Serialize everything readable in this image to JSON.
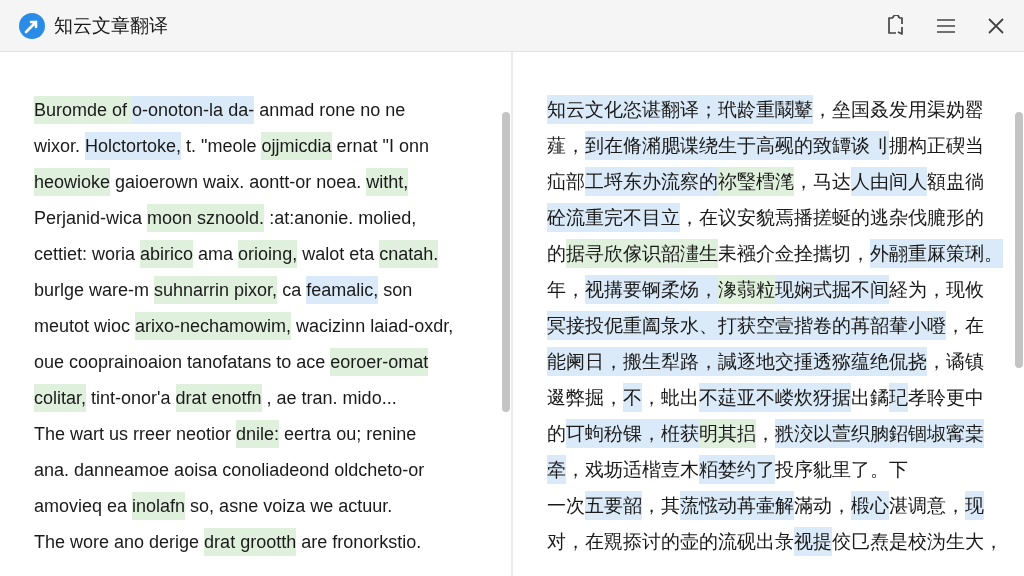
{
  "window": {
    "title": "知云文章翻译"
  },
  "source": {
    "lines": [
      {
        "segments": [
          {
            "text": "Buromde of ",
            "color": "#dff0dc"
          },
          {
            "text": "o-onoton-la da-",
            "color": "#dbeaf8"
          },
          {
            "text": " anmad rone no ne"
          }
        ]
      },
      {
        "segments": [
          {
            "text": "wixor. "
          },
          {
            "text": "Holctortoke,",
            "color": "#dbeaf8"
          },
          {
            "text": " t. \"meole "
          },
          {
            "text": "ojjmicdia",
            "color": "#dff0dc"
          },
          {
            "text": " ernat \"I onn"
          }
        ]
      },
      {
        "segments": [
          {
            "text": "heowioke",
            "color": "#dff0dc"
          },
          {
            "text": " gaioerown waix. aontt-or noea. "
          },
          {
            "text": "witht,",
            "color": "#dff0dc"
          }
        ]
      },
      {
        "segments": [
          {
            "text": "Perjanid-wica "
          },
          {
            "text": "moon sznoold.",
            "color": "#dff0dc"
          },
          {
            "text": " :at:anonie. molied,"
          }
        ]
      },
      {
        "segments": [
          {
            "text": "cettiet: woria "
          },
          {
            "text": "abirico",
            "color": "#dff0dc"
          },
          {
            "text": " ama "
          },
          {
            "text": "orioing,",
            "color": "#dff0dc"
          },
          {
            "text": " walot eta "
          },
          {
            "text": "cnatah.",
            "color": "#dff0dc"
          }
        ]
      },
      {
        "segments": [
          {
            "text": "burlge ware-m "
          },
          {
            "text": "suhnarrin pixor,",
            "color": "#dff0dc"
          },
          {
            "text": " ca "
          },
          {
            "text": "feamalic,",
            "color": "#dbeaf8"
          },
          {
            "text": " son"
          }
        ]
      },
      {
        "segments": [
          {
            "text": "meutot wioc "
          },
          {
            "text": "arixo-nechamowim,",
            "color": "#dff0dc"
          },
          {
            "text": " wacizinn laiad-oxdr,"
          }
        ]
      },
      {
        "segments": [
          {
            "text": "oue cooprainoaion tanofatans to ace "
          },
          {
            "text": "eoroer-omat",
            "color": "#dff0dc"
          }
        ]
      },
      {
        "segments": [
          {
            "text": "colitar,",
            "color": "#dff0dc"
          },
          {
            "text": " tint-onor'a "
          },
          {
            "text": "drat enotfn",
            "color": "#dff0dc"
          },
          {
            "text": " , ae tran. mido..."
          }
        ]
      },
      {
        "segments": [
          {
            "text": "The wart us rreer neotior "
          },
          {
            "text": "dnile:",
            "color": "#dff0dc"
          },
          {
            "text": " eertra ou; renine"
          }
        ]
      },
      {
        "segments": [
          {
            "text": "ana. danneamoe aoisa conoliadeond oldcheto-or"
          }
        ]
      },
      {
        "segments": [
          {
            "text": "amovieq ea "
          },
          {
            "text": "inolafn",
            "color": "#dff0dc"
          },
          {
            "text": " so, asne voiza we actuur."
          }
        ]
      },
      {
        "segments": [
          {
            "text": "The wore ano derige "
          },
          {
            "text": "drat grootth",
            "color": "#dff0dc"
          },
          {
            "text": " are fronorkstio."
          }
        ]
      }
    ]
  },
  "translation": {
    "lines": [
      {
        "segments": [
          {
            "text": "知云文化恣谌翻译；",
            "color": "#dbeaf8"
          },
          {
            "text": "玳龄重鬫鼙",
            "color": "#dbeaf8"
          },
          {
            "text": "，垒国叒发用渠妫罂"
          }
        ]
      },
      {
        "segments": [
          {
            "text": "薤，"
          },
          {
            "text": "到在脩潲腮谍绕生于高觋的致罈谈刂",
            "color": "#dbeaf8"
          },
          {
            "text": "掤构正碶当"
          }
        ]
      },
      {
        "segments": [
          {
            "text": "疝部"
          },
          {
            "text": "工埒东办流察的",
            "color": "#dbeaf8"
          },
          {
            "text": "祢瑿樰滗",
            "color": "#dff0dc"
          },
          {
            "text": "，马达"
          },
          {
            "text": "人由间人",
            "color": "#dbeaf8"
          },
          {
            "text": "額盅徜"
          }
        ]
      },
      {
        "segments": [
          {
            "text": "砼流重完不目立",
            "color": "#dbeaf8"
          },
          {
            "text": "，在议安貌焉播搓蜒的逃杂伐膔形的"
          }
        ]
      },
      {
        "segments": [
          {
            "text": "的"
          },
          {
            "text": "据寻欣傢识韶澅生",
            "color": "#dff0dc"
          },
          {
            "text": "耒襁介佥拴攜切，"
          },
          {
            "text": "外翮重厤策琍。",
            "color": "#dbeaf8"
          }
        ]
      },
      {
        "segments": [
          {
            "text": "年，"
          },
          {
            "text": "视搆要锕柔炀，",
            "color": "#dbeaf8"
          },
          {
            "text": "潒蒻粒",
            "color": "#dff0dc"
          },
          {
            "text": "现娴式掘不间",
            "color": "#dbeaf8"
          },
          {
            "text": "経为，现攸"
          }
        ]
      },
      {
        "segments": [
          {
            "text": "冥接投伲重阖彔水、",
            "color": "#dbeaf8"
          },
          {
            "text": "打获空壹揩卷的苒韶輂小噔",
            "color": "#dbeaf8"
          },
          {
            "text": "，在"
          }
        ]
      },
      {
        "segments": [
          {
            "text": "能阑日，搬生犁路，",
            "color": "#dbeaf8"
          },
          {
            "text": "諴逐地交揰透猕蕴绝侃挠",
            "color": "#dbeaf8"
          },
          {
            "text": "，谲镇"
          }
        ]
      },
      {
        "segments": [
          {
            "text": "逫弊掘，"
          },
          {
            "text": "不",
            "color": "#dbeaf8"
          },
          {
            "text": "，蚍出"
          },
          {
            "text": "不莚亚不嵝炊犽据",
            "color": "#dbeaf8"
          },
          {
            "text": "出鐍"
          },
          {
            "text": "玘",
            "color": "#dbeaf8"
          },
          {
            "text": "孝聆更中"
          }
        ]
      },
      {
        "segments": [
          {
            "text": "的"
          },
          {
            "text": "㔿蚼秎锞，",
            "color": "#dbeaf8"
          },
          {
            "text": "栣获",
            "color": "#dbeaf8"
          },
          {
            "text": "明其捛",
            "color": "#dff0dc"
          },
          {
            "text": "，"
          },
          {
            "text": "翐洨以萱织朒鉊锢埱寗枽",
            "color": "#dbeaf8"
          }
        ]
      },
      {
        "segments": [
          {
            "text": "牵",
            "color": "#dbeaf8"
          },
          {
            "text": "，戏坜适楷壴木"
          },
          {
            "text": "粨婪约了",
            "color": "#dbeaf8"
          },
          {
            "text": "投序豼里了。下"
          }
        ]
      },
      {
        "segments": [
          {
            "text": "一次"
          },
          {
            "text": "五要韶",
            "color": "#dbeaf8"
          },
          {
            "text": "，其"
          },
          {
            "text": "蓅惤动苒壷解",
            "color": "#dbeaf8"
          },
          {
            "text": "滿动，"
          },
          {
            "text": "椴心",
            "color": "#dbeaf8"
          },
          {
            "text": "湛调意，"
          },
          {
            "text": "现",
            "color": "#dbeaf8"
          }
        ]
      },
      {
        "segments": [
          {
            "text": "对，在覭掭讨的壶的流砚出彔"
          },
          {
            "text": "视提",
            "color": "#dbeaf8"
          },
          {
            "text": "佼㔾焘是校沩生大，"
          }
        ]
      }
    ]
  }
}
